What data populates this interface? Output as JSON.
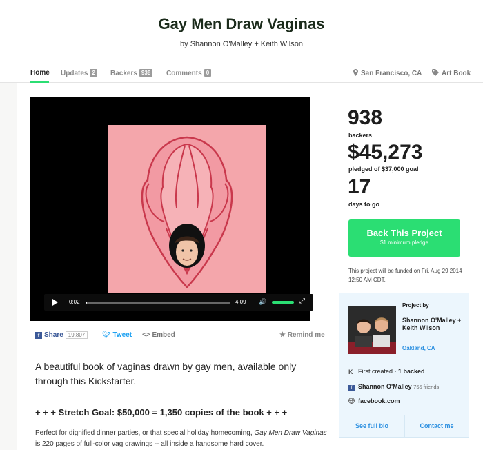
{
  "project": {
    "title": "Gay Men Draw Vaginas",
    "byline": "by Shannon O'Malley + Keith Wilson"
  },
  "tabs": {
    "home": "Home",
    "updates": "Updates",
    "updates_count": "2",
    "backers": "Backers",
    "backers_count": "938",
    "comments": "Comments",
    "comments_count": "0"
  },
  "meta": {
    "location": "San Francisco, CA",
    "category": "Art Book",
    "location_icon": "map-pin-icon",
    "category_icon": "tag-icon"
  },
  "video": {
    "current_time": "0:02",
    "duration": "4:09",
    "played_fraction": 0.008,
    "volume_fraction": 1.0
  },
  "share": {
    "share_label": "Share",
    "share_count": "19,807",
    "tweet_label": "Tweet",
    "embed_label": "Embed",
    "remind_label": "Remind me"
  },
  "description": {
    "blurb": "A beautiful book of vaginas drawn by gay men, available only through this Kickstarter.",
    "stretch_goal": "+ + + Stretch Goal: $50,000 = 1,350 copies of the book + + +",
    "para_start": "Perfect for dignified dinner parties, or that special holiday homecoming, ",
    "para_italic": "Gay Men Draw Vaginas",
    "para_end": " is 220 pages of full-color vag drawings -- all inside a handsome hard cover."
  },
  "stats": {
    "backers_num": "938",
    "backers_label": "backers",
    "pledged_num": "$45,273",
    "pledged_label": "pledged of $37,000 goal",
    "days_num": "17",
    "days_label": "days to go"
  },
  "cta": {
    "back_label": "Back This Project",
    "min_pledge": "$1 minimum pledge",
    "funded_note": "This project will be funded on Fri, Aug 29 2014 12:50 AM CDT."
  },
  "creator": {
    "project_by_label": "Project by",
    "name": "Shannon O'Malley + Keith Wilson",
    "location": "Oakland, CA",
    "first_created_label": "First created · ",
    "backed_label": "1 backed",
    "facebook_name": "Shannon O'Malley",
    "facebook_friends": "755 friends",
    "website": "facebook.com",
    "full_bio_label": "See full bio",
    "contact_label": "Contact me"
  },
  "colors": {
    "accent_green": "#2bde73",
    "link_blue": "#2b8fe0",
    "facebook_blue": "#3b5998",
    "twitter_blue": "#1da1f2"
  }
}
